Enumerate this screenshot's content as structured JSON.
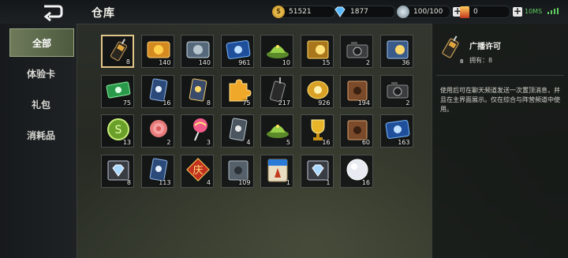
{
  "header": {
    "title": "仓库",
    "gold": "51521",
    "diamonds": "1877",
    "energy": "100/100",
    "tickets": "0",
    "latency": "10MS"
  },
  "nav": {
    "items": [
      "全部",
      "体验卡",
      "礼包",
      "消耗品"
    ],
    "active_index": 0
  },
  "items": [
    {
      "icon": "radio-icon",
      "qty": "8",
      "selected": true
    },
    {
      "icon": "gold-ticket-icon",
      "qty": "140",
      "label": "白金"
    },
    {
      "icon": "silver-ticket-icon",
      "qty": "140",
      "label": "白金"
    },
    {
      "icon": "blue-ticket-icon",
      "qty": "961"
    },
    {
      "icon": "green-hat-icon",
      "qty": "10"
    },
    {
      "icon": "gold-coupon-icon",
      "qty": "15",
      "label": "白月"
    },
    {
      "icon": "camera-icon",
      "qty": "2"
    },
    {
      "icon": "blue-coupon-icon",
      "qty": "36",
      "label": "白月"
    },
    {
      "icon": "green-card-icon",
      "qty": "75"
    },
    {
      "icon": "blue-card-icon",
      "qty": "16"
    },
    {
      "icon": "gold-card-icon",
      "qty": "8"
    },
    {
      "icon": "puzzle-icon",
      "qty": "75"
    },
    {
      "icon": "walkie-icon",
      "qty": "217"
    },
    {
      "icon": "gold-token-icon",
      "qty": "926"
    },
    {
      "icon": "book-icon",
      "qty": "194"
    },
    {
      "icon": "camera-icon",
      "qty": "2"
    },
    {
      "icon": "green-coin-icon",
      "qty": "13"
    },
    {
      "icon": "rose-icon",
      "qty": "2"
    },
    {
      "icon": "lollipop-icon",
      "qty": "3"
    },
    {
      "icon": "gray-card-icon",
      "qty": "4"
    },
    {
      "icon": "green-hat-icon",
      "qty": "5"
    },
    {
      "icon": "trophy-icon",
      "qty": "16"
    },
    {
      "icon": "book-icon",
      "qty": "60"
    },
    {
      "icon": "blue-ticket-icon",
      "qty": "163"
    },
    {
      "icon": "diamond-coupon-icon",
      "qty": "8",
      "label": "协议"
    },
    {
      "icon": "blue-card-icon",
      "qty": "113"
    },
    {
      "icon": "red-badge-icon",
      "qty": "4",
      "label": "庆"
    },
    {
      "icon": "gray-book-icon",
      "qty": "109"
    },
    {
      "icon": "gift-card-icon",
      "qty": "1",
      "label": "体验卡"
    },
    {
      "icon": "diamond-coupon-icon",
      "qty": "1",
      "label": "协议"
    },
    {
      "icon": "snowball-icon",
      "qty": "16"
    }
  ],
  "detail": {
    "name": "广播许可",
    "qty": "8",
    "owned": "拥有：8",
    "description": "使用后可在聊天频道发送一次置顶消息，并且在主界面展示。仅在综合与阵营频道中使用。"
  },
  "colors": {
    "accent_green": "#3cd64a",
    "selected_border": "#e2c588",
    "nav_active": "#6e7a5a"
  }
}
